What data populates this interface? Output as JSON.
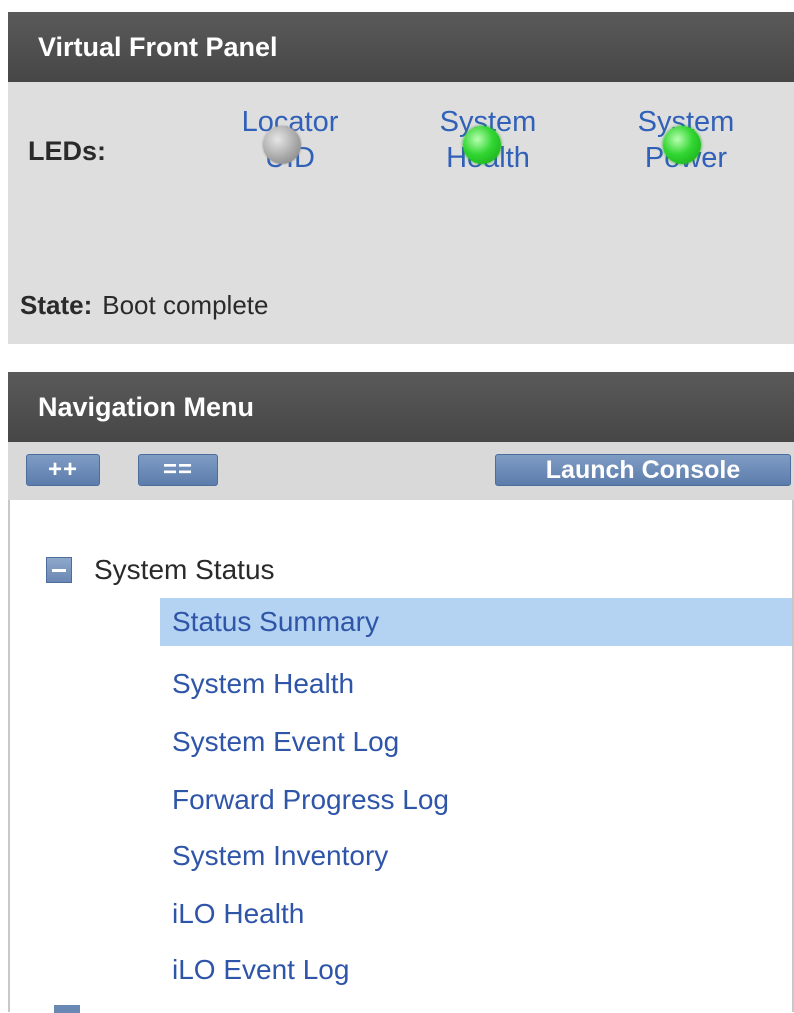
{
  "virtual_front_panel": {
    "title": "Virtual Front Panel",
    "leds_label": "LEDs:",
    "leds": [
      {
        "name_line1": "Locator",
        "name_line2": "UID",
        "status": "off",
        "color": "#a8a8a8"
      },
      {
        "name_line1": "System",
        "name_line2": "Health",
        "status": "on",
        "color": "#32d632"
      },
      {
        "name_line1": "System",
        "name_line2": "Power",
        "status": "on",
        "color": "#32d632"
      }
    ],
    "state_label": "State:",
    "state_value": "Boot complete"
  },
  "navigation_menu": {
    "title": "Navigation Menu",
    "expand_all_label": "++",
    "collapse_all_label": "==",
    "launch_console_label": "Launch Console",
    "group": {
      "label": "System Status",
      "expanded": true,
      "icon": "collapse-minus-icon"
    },
    "items": [
      {
        "label": "Status Summary",
        "selected": true
      },
      {
        "label": "System Health",
        "selected": false
      },
      {
        "label": "System Event Log",
        "selected": false
      },
      {
        "label": "Forward Progress Log",
        "selected": false
      },
      {
        "label": "System Inventory",
        "selected": false
      },
      {
        "label": "iLO Health",
        "selected": false
      },
      {
        "label": "iLO Event Log",
        "selected": false
      }
    ]
  },
  "colors": {
    "header_bg": "#4e4e4e",
    "panel_bg": "#dedede",
    "link_blue": "#2e55a8",
    "selected_bg": "#b4d2f2",
    "button_blue": "#6a88b4"
  }
}
